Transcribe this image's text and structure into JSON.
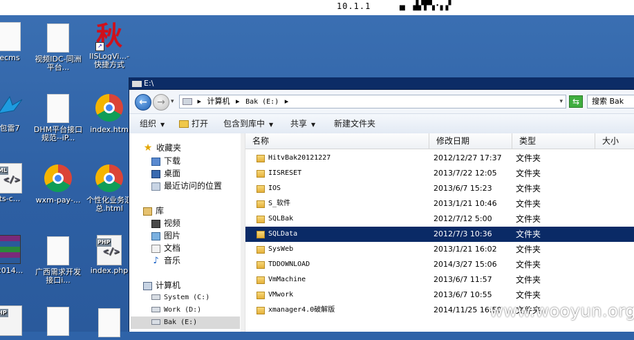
{
  "top": {
    "ip": "10.1.1",
    "garble": "▗▖ ▟▞▛▚·▖▞"
  },
  "desktop_icons": [
    {
      "label": "ecms",
      "kind": "doc"
    },
    {
      "label": "视频IDC-同洲平台...",
      "kind": "doc"
    },
    {
      "label": "IISLogVi...- 快捷方式",
      "kind": "qiu",
      "glyph": "秋"
    },
    {
      "label": "包雷7",
      "kind": "bird"
    },
    {
      "label": "DHM平台接口规范--iP...",
      "kind": "doc"
    },
    {
      "label": "index.htm",
      "kind": "chrome"
    },
    {
      "label": "ts-c...",
      "kind": "code",
      "tag": "ML"
    },
    {
      "label": "wxm-pay-...",
      "kind": "chrome"
    },
    {
      "label": "个性化业务汇总.html",
      "kind": "chrome"
    },
    {
      "label": "2014...",
      "kind": "winrar"
    },
    {
      "label": "广西需求开发接口i...",
      "kind": "doc"
    },
    {
      "label": "index.php",
      "kind": "code",
      "tag": "PHP"
    },
    {
      "label": "",
      "kind": "code",
      "tag": "HP"
    },
    {
      "label": "",
      "kind": "doc"
    },
    {
      "label": "",
      "kind": "doc"
    }
  ],
  "window": {
    "title": "E:\\",
    "address": {
      "root": "▸",
      "computer": "计算机",
      "drive": "Bak (E:)",
      "sep": "▸"
    },
    "search_placeholder": "搜索 Bak",
    "toolbar": {
      "organize": "组织",
      "open": "打开",
      "include": "包含到库中",
      "share": "共享",
      "new_folder": "新建文件夹"
    },
    "nav": {
      "favorites": "收藏夹",
      "downloads": "下载",
      "desktop": "桌面",
      "recent": "最近访问的位置",
      "libraries": "库",
      "videos": "视频",
      "pictures": "图片",
      "documents": "文档",
      "music": "音乐",
      "computer": "计算机",
      "system_c": "System (C:)",
      "work_d": "Work (D:)",
      "bak_e": "Bak (E:)"
    },
    "columns": {
      "name": "名称",
      "date": "修改日期",
      "type": "类型",
      "size": "大小"
    },
    "files": [
      {
        "name": "HitvBak20121227",
        "date": "2012/12/27 17:37",
        "type": "文件夹",
        "selected": false
      },
      {
        "name": "IISRESET",
        "date": "2013/7/22 12:05",
        "type": "文件夹",
        "selected": false
      },
      {
        "name": "IOS",
        "date": "2013/6/7 15:23",
        "type": "文件夹",
        "selected": false
      },
      {
        "name": "S_软件",
        "date": "2013/1/21 10:46",
        "type": "文件夹",
        "selected": false
      },
      {
        "name": "SQLBak",
        "date": "2012/7/12 5:00",
        "type": "文件夹",
        "selected": false
      },
      {
        "name": "SQLData",
        "date": "2012/7/3 10:36",
        "type": "文件夹",
        "selected": true
      },
      {
        "name": "SysWeb",
        "date": "2013/1/21 16:02",
        "type": "文件夹",
        "selected": false
      },
      {
        "name": "TDDOWNLOAD",
        "date": "2014/3/27 15:06",
        "type": "文件夹",
        "selected": false
      },
      {
        "name": "VmMachine",
        "date": "2013/6/7 11:57",
        "type": "文件夹",
        "selected": false
      },
      {
        "name": "VMwork",
        "date": "2013/6/7 10:55",
        "type": "文件夹",
        "selected": false
      },
      {
        "name": "xmanager4.0破解版",
        "date": "2014/11/25 16:50",
        "type": "文件夹",
        "selected": false
      }
    ]
  },
  "watermark": "www.wooyun.org",
  "colors": {
    "selection": "#0a2a66",
    "titlebar": "#0c2c66",
    "desktop": "#2f63a8"
  }
}
